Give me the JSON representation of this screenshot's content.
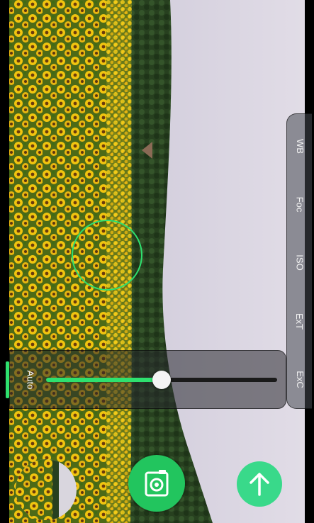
{
  "camera": {
    "mode_panel": {
      "items": [
        {
          "label": "WB"
        },
        {
          "label": "Foc"
        },
        {
          "label": "ISO"
        },
        {
          "label": "ExT"
        },
        {
          "label": "ExC"
        }
      ]
    },
    "exposure_slider": {
      "label": "Auto",
      "value_fraction": 0.5
    },
    "buttons": {
      "capture_icon": "camera-icon",
      "upload_icon": "arrow-up-icon"
    },
    "accent_color": "#2ee06f"
  }
}
